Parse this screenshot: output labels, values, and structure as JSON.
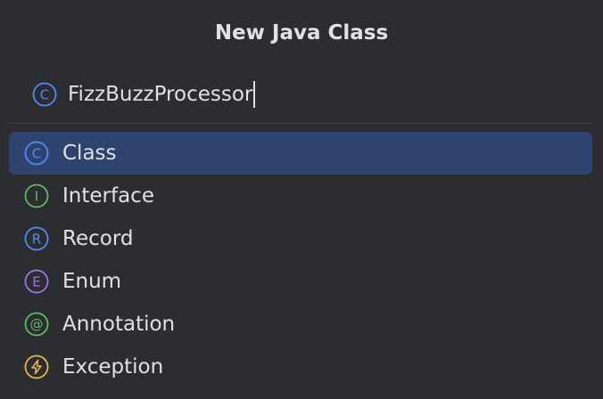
{
  "dialog": {
    "title": "New Java Class"
  },
  "name_field": {
    "value": "FizzBuzzProcessor",
    "icon": "class-icon"
  },
  "kinds": [
    {
      "label": "Class",
      "icon": "class-icon",
      "letter": "C",
      "color": "#548af7",
      "selected": true
    },
    {
      "label": "Interface",
      "icon": "interface-icon",
      "letter": "I",
      "color": "#5fb865",
      "selected": false
    },
    {
      "label": "Record",
      "icon": "record-icon",
      "letter": "R",
      "color": "#548af7",
      "selected": false
    },
    {
      "label": "Enum",
      "icon": "enum-icon",
      "letter": "E",
      "color": "#a571e6",
      "selected": false
    },
    {
      "label": "Annotation",
      "icon": "annotation-icon",
      "letter": "@",
      "color": "#5fb865",
      "selected": false
    },
    {
      "label": "Exception",
      "icon": "exception-icon",
      "letter": "⚡",
      "color": "#e5b453",
      "selected": false
    }
  ],
  "colors": {
    "background": "#2b2d30",
    "selection": "#2e436e",
    "text": "#dfe1e5"
  }
}
